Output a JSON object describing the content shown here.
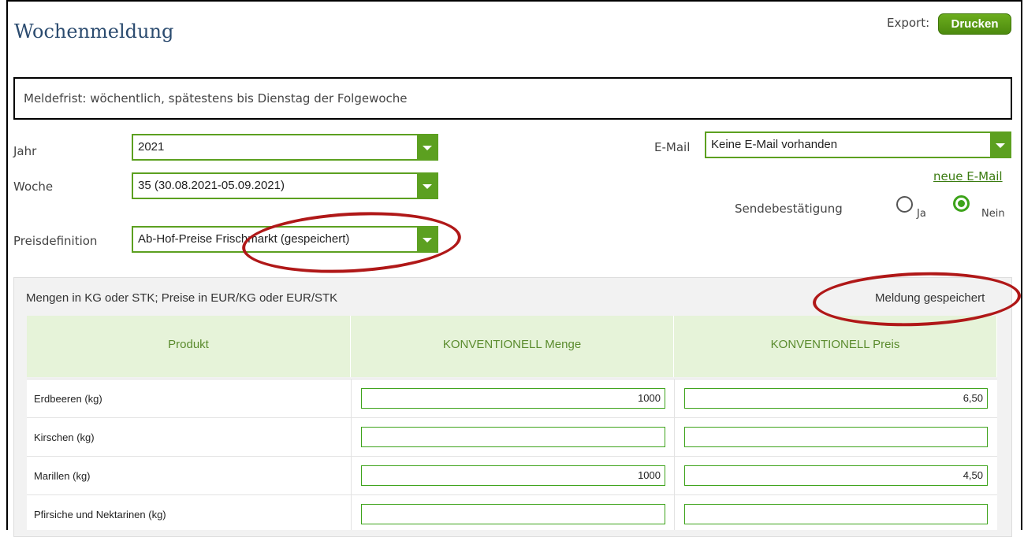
{
  "header": {
    "title": "Wochenmeldung",
    "export_label": "Export:",
    "print_button": "Drucken"
  },
  "notice": "Meldefrist: wöchentlich, spätestens bis Dienstag der Folgewoche",
  "form": {
    "jahr": {
      "label": "Jahr",
      "value": "2021"
    },
    "woche": {
      "label": "Woche",
      "value": "35 (30.08.2021-05.09.2021)"
    },
    "preisdefinition": {
      "label": "Preisdefinition",
      "value": "Ab-Hof-Preise Frischmarkt (gespeichert)"
    },
    "email": {
      "label": "E-Mail",
      "value": "Keine E-Mail vorhanden"
    },
    "new_email_link": "neue E-Mail",
    "confirmation": {
      "label": "Sendebestätigung",
      "option_yes": "Ja",
      "option_no": "Nein",
      "selected": "Nein"
    }
  },
  "table": {
    "units_note": "Mengen in KG oder STK; Preise in EUR/KG oder EUR/STK",
    "status": "Meldung gespeichert",
    "headers": [
      "Produkt",
      "KONVENTIONELL Menge",
      "KONVENTIONELL Preis"
    ],
    "rows": [
      {
        "product": "Erdbeeren (kg)",
        "menge": "1000",
        "preis": "6,50"
      },
      {
        "product": "Kirschen (kg)",
        "menge": "",
        "preis": ""
      },
      {
        "product": "Marillen (kg)",
        "menge": "1000",
        "preis": "4,50"
      },
      {
        "product": "Pfirsiche und Nektarinen (kg)",
        "menge": "",
        "preis": ""
      }
    ]
  },
  "colors": {
    "accent_green": "#5ca020",
    "highlight_red": "#b01818",
    "title_blue": "#2b4b6f"
  }
}
